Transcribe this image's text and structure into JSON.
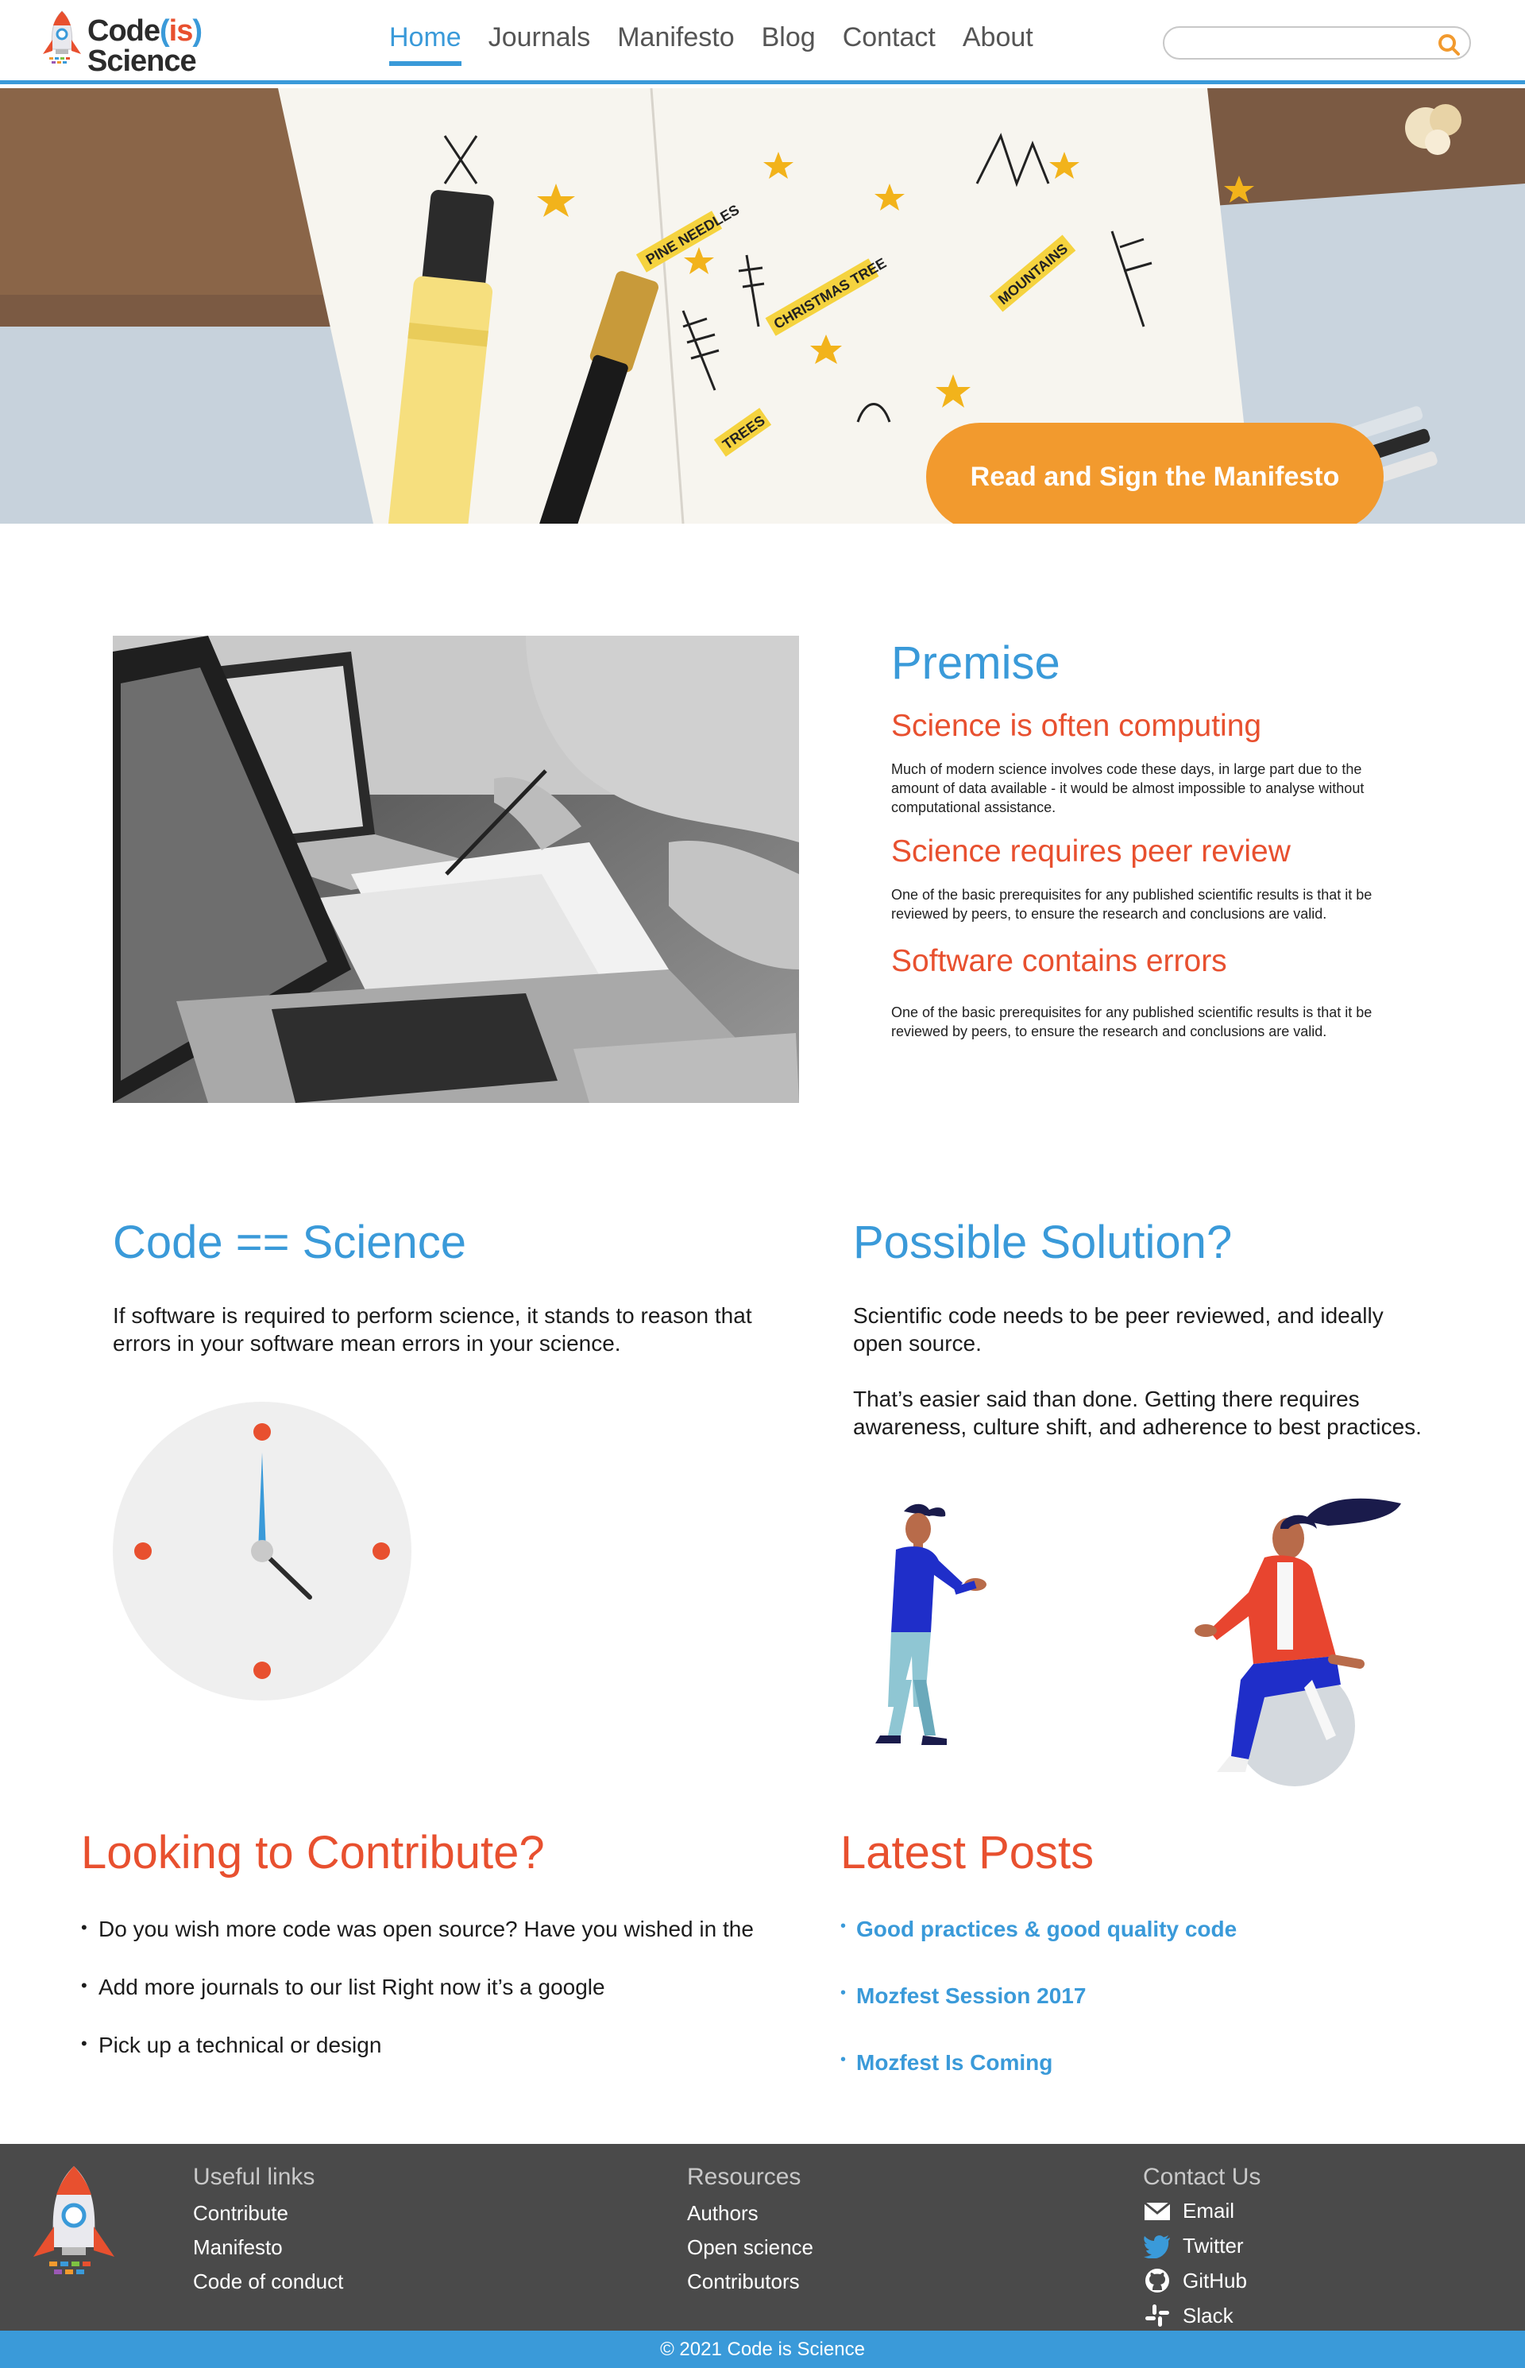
{
  "site": {
    "logo_text": {
      "part1": "Code",
      "paren_open": "(",
      "is": "is",
      "paren_close": ")",
      "part2": "Science"
    },
    "nav": [
      "Home",
      "Journals",
      "Manifesto",
      "Blog",
      "Contact",
      "About"
    ],
    "active_nav": "Home",
    "search": {
      "placeholder": "",
      "value": ""
    }
  },
  "hero": {
    "cta_label": "Read and Sign the Manifesto",
    "photo_labels": [
      "PINE NEEDLES",
      "CHRISTMAS TREE",
      "MOUNTAINS",
      "TREES",
      "STARS"
    ]
  },
  "premise": {
    "title": "Premise",
    "items": [
      {
        "heading": "Science is often computing",
        "text": "Much of modern science involves code these days, in large part due to the amount of data available - it would be almost impossible to analyse without computational assistance."
      },
      {
        "heading": "Science requires peer review",
        "text": "One of the basic prerequisites for any published scientific results is that it be reviewed by peers, to ensure the research and conclusions are valid."
      },
      {
        "heading": "Software contains errors",
        "text": "One of the basic prerequisites for any published scientific results is that it be reviewed by peers, to ensure the research and conclusions are valid."
      }
    ]
  },
  "code_science": {
    "title": "Code == Science",
    "text": "If software is required to perform science, it stands to reason that errors in your software mean errors in your science."
  },
  "solution": {
    "title": "Possible Solution?",
    "text1": "Scientific code needs to be peer reviewed, and ideally open source.",
    "text2": "That’s easier said than done. Getting there requires awareness, culture shift, and adherence to best practices."
  },
  "contribute": {
    "title": "Looking to Contribute?",
    "items": [
      "Do you wish more code was open source? Have you wished in the",
      "Add more journals to our list Right now it’s a google",
      "Pick up a technical or design"
    ]
  },
  "posts": {
    "title": "Latest Posts",
    "items": [
      "Good practices & good quality code",
      "Mozfest Session 2017",
      "Mozfest Is Coming"
    ]
  },
  "footer": {
    "useful_links": {
      "title": "Useful links",
      "links": [
        "Contribute",
        "Manifesto",
        "Code of conduct"
      ]
    },
    "resources": {
      "title": "Resources",
      "links": [
        "Authors",
        "Open science",
        "Contributors"
      ]
    },
    "contact": {
      "title": "Contact Us",
      "items": [
        {
          "label": "Email",
          "icon": "email-icon"
        },
        {
          "label": "Twitter",
          "icon": "twitter-icon"
        },
        {
          "label": "GitHub",
          "icon": "github-icon"
        },
        {
          "label": "Slack",
          "icon": "slack-icon"
        }
      ]
    },
    "copyright": "© 2021 Code is Science"
  },
  "colors": {
    "brand_blue": "#3a9ad9",
    "brand_red": "#e8502f",
    "brand_orange": "#f29a2e",
    "footer_bg": "#4a4a4a"
  }
}
